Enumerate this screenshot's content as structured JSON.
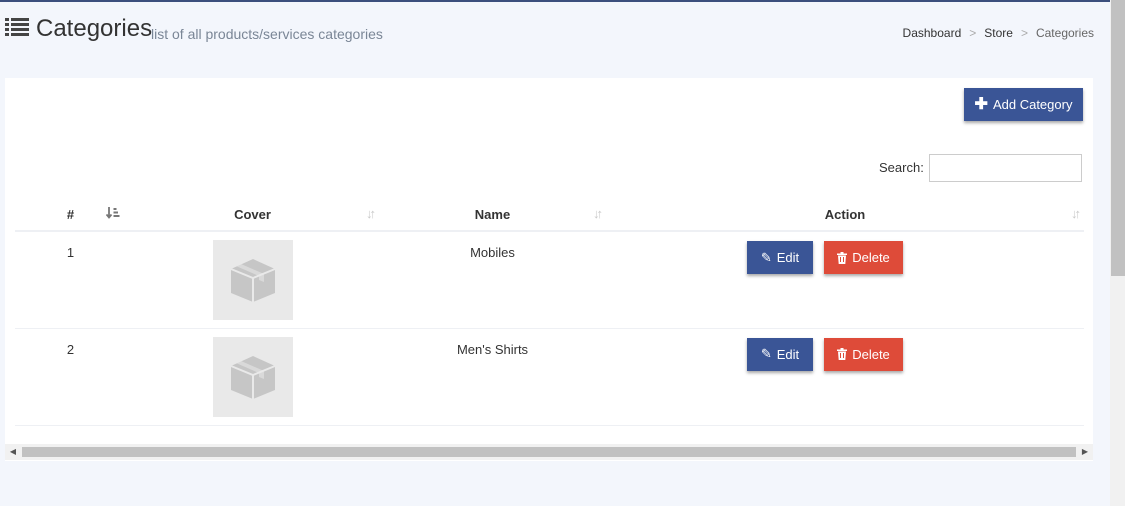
{
  "header": {
    "title": "Categories",
    "subtitle": "list of all products/services categories",
    "icon": "list-icon"
  },
  "breadcrumb": {
    "items": [
      "Dashboard",
      "Store",
      "Categories"
    ],
    "separator": ">"
  },
  "toolbar": {
    "add_label": "Add Category",
    "add_icon": "plus-icon"
  },
  "search": {
    "label": "Search:",
    "value": "",
    "placeholder": ""
  },
  "table": {
    "columns": [
      "#",
      "Cover",
      "Name",
      "Action"
    ],
    "sort": {
      "column": "#",
      "direction": "ascending"
    },
    "rows": [
      {
        "num": "1",
        "name": "Mobiles",
        "cover_icon": "box-icon"
      },
      {
        "num": "2",
        "name": "Men's Shirts",
        "cover_icon": "box-icon"
      }
    ],
    "edit_label": "Edit",
    "delete_label": "Delete"
  },
  "colors": {
    "primary": "#3a5596",
    "danger": "#de4b39",
    "background": "#f3f6fc",
    "topbar": "#3b4f7d"
  }
}
